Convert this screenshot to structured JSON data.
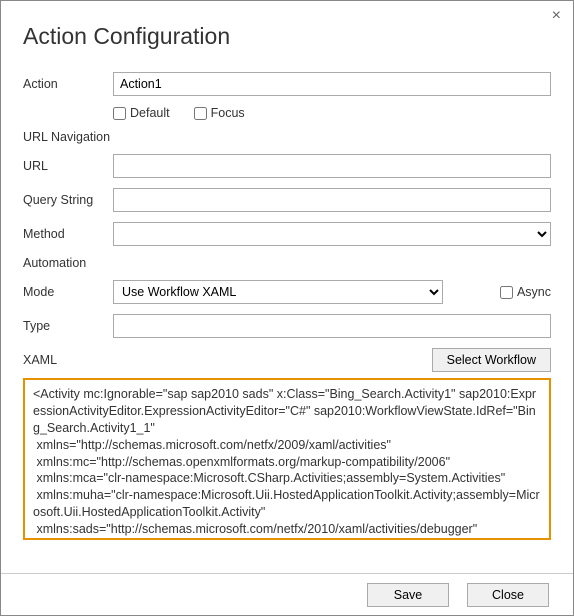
{
  "dialog": {
    "title": "Action Configuration",
    "close_icon": "×"
  },
  "action": {
    "label": "Action",
    "value": "Action1",
    "default_label": "Default",
    "default_checked": false,
    "focus_label": "Focus",
    "focus_checked": false
  },
  "url_nav": {
    "section_label": "URL Navigation",
    "url_label": "URL",
    "url_value": "",
    "query_label": "Query String",
    "query_value": "",
    "method_label": "Method",
    "method_value": ""
  },
  "automation": {
    "section_label": "Automation",
    "mode_label": "Mode",
    "mode_value": "Use Workflow XAML",
    "async_label": "Async",
    "async_checked": false,
    "type_label": "Type",
    "type_value": "",
    "xaml_label": "XAML",
    "select_workflow_label": "Select Workflow",
    "xaml_text": "<Activity mc:Ignorable=\"sap sap2010 sads\" x:Class=\"Bing_Search.Activity1\" sap2010:ExpressionActivityEditor.ExpressionActivityEditor=\"C#\" sap2010:WorkflowViewState.IdRef=\"Bing_Search.Activity1_1\"\n xmlns=\"http://schemas.microsoft.com/netfx/2009/xaml/activities\"\n xmlns:mc=\"http://schemas.openxmlformats.org/markup-compatibility/2006\"\n xmlns:mca=\"clr-namespace:Microsoft.CSharp.Activities;assembly=System.Activities\"\n xmlns:muha=\"clr-namespace:Microsoft.Uii.HostedApplicationToolkit.Activity;assembly=Microsoft.Uii.HostedApplicationToolkit.Activity\"\n xmlns:sads=\"http://schemas.microsoft.com/netfx/2010/xaml/activities/debugger\""
  },
  "footer": {
    "save_label": "Save",
    "close_label": "Close"
  }
}
